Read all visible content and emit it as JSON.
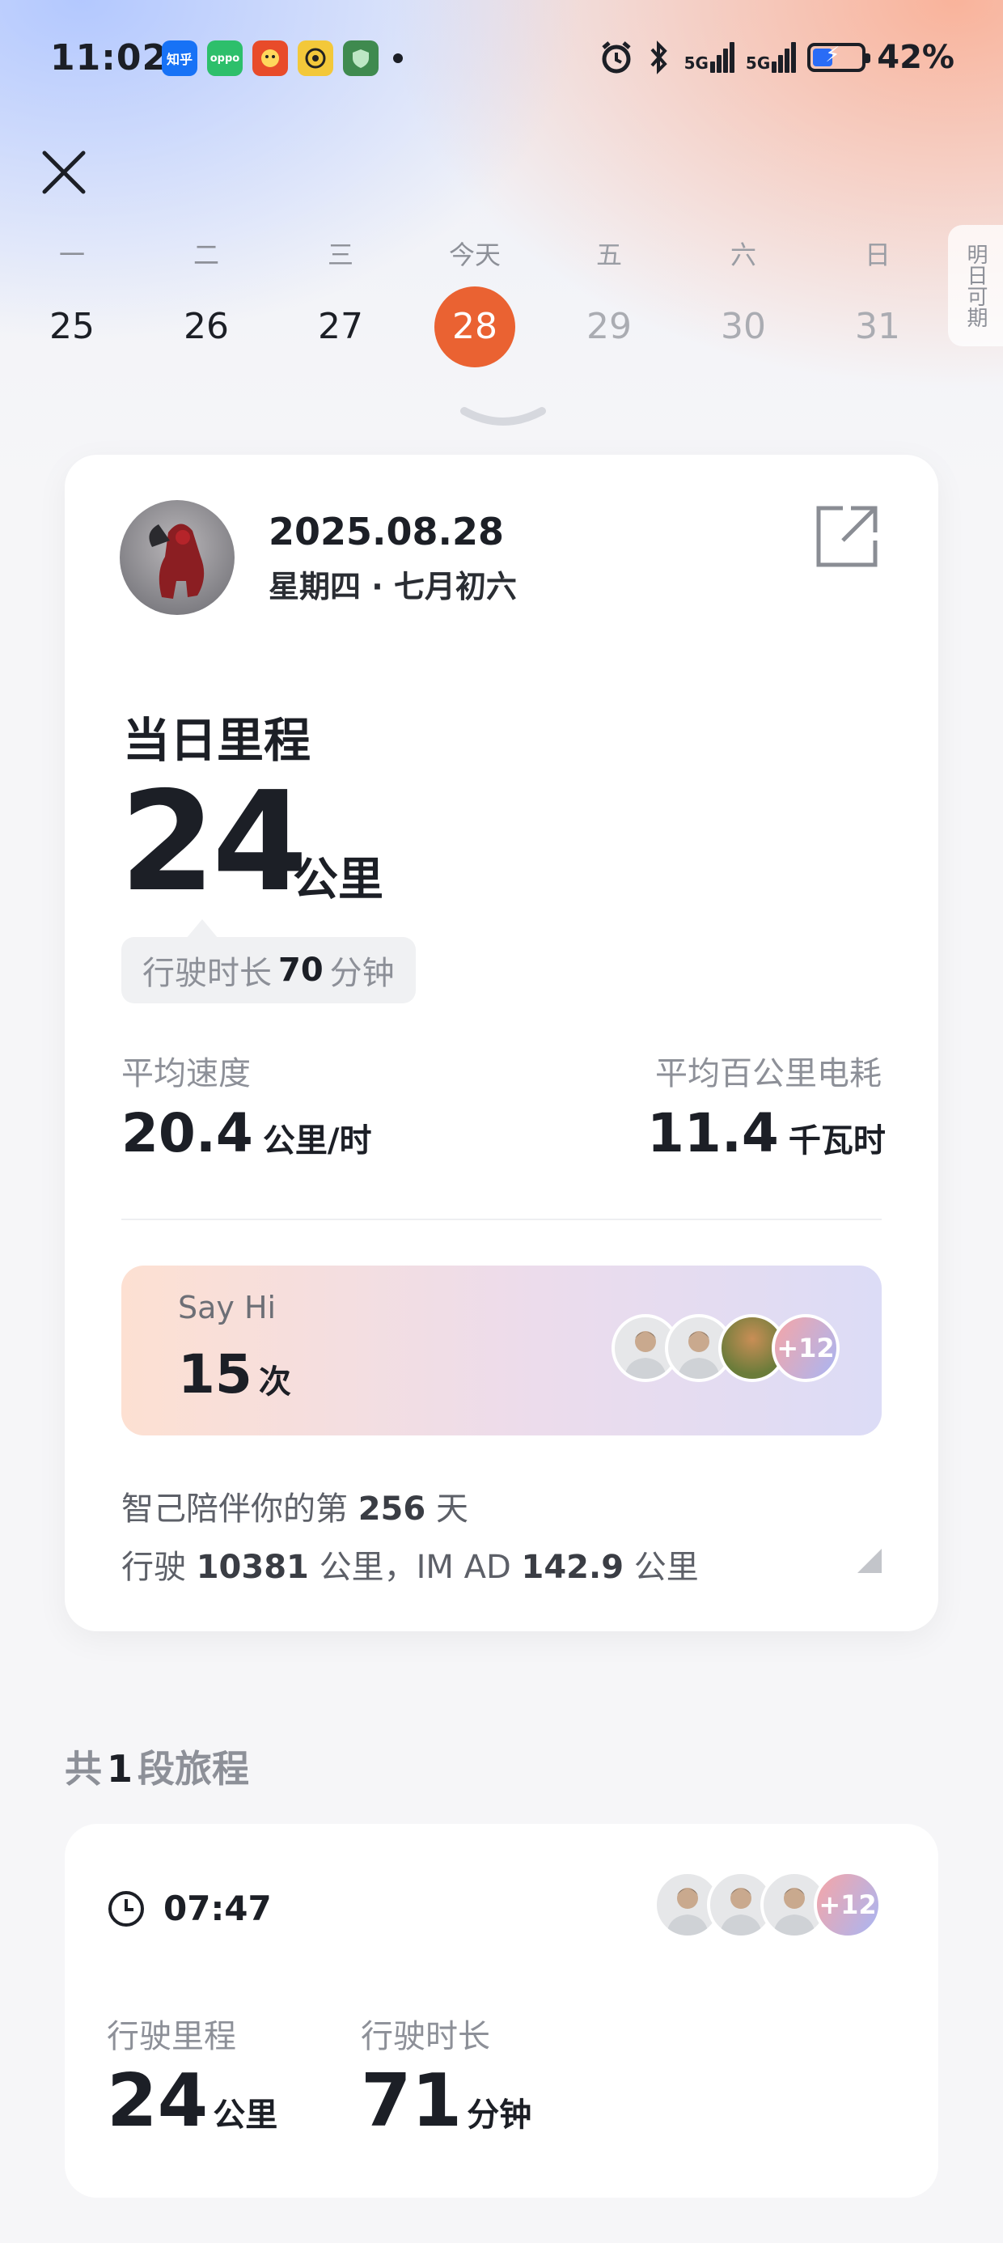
{
  "status_bar": {
    "time": "11:02",
    "apps": [
      {
        "name": "zhihu-app-icon",
        "label": "知乎"
      },
      {
        "name": "oppo-app-icon",
        "label": "oppo"
      },
      {
        "name": "game-app-icon",
        "label": ""
      },
      {
        "name": "music-app-icon",
        "label": ""
      },
      {
        "name": "shield-app-icon",
        "label": ""
      }
    ],
    "network_1": "5G",
    "network_2": "5G",
    "battery_level": 0.42,
    "battery_text": "42%",
    "battery_color": "#2a6cf6"
  },
  "week": {
    "days": [
      {
        "label": "一",
        "num": "25",
        "state": "past"
      },
      {
        "label": "二",
        "num": "26",
        "state": "past"
      },
      {
        "label": "三",
        "num": "27",
        "state": "past"
      },
      {
        "label": "今天",
        "num": "28",
        "state": "today"
      },
      {
        "label": "五",
        "num": "29",
        "state": "future"
      },
      {
        "label": "六",
        "num": "30",
        "state": "future"
      },
      {
        "label": "日",
        "num": "31",
        "state": "future"
      }
    ],
    "next_label": "明日可期",
    "today_color": "#ea6232"
  },
  "summary": {
    "date": "2025.08.28",
    "weekday_lunar": "星期四 · 七月初六",
    "title": "当日里程",
    "distance": "24",
    "distance_unit": "公里",
    "duration_prefix": "行驶时长",
    "duration_value": "70",
    "duration_unit": "分钟",
    "avg_speed_label": "平均速度",
    "avg_speed_value": "20.4",
    "avg_speed_unit": "公里/时",
    "energy_label": "平均百公里电耗",
    "energy_value": "11.4",
    "energy_unit": "千瓦时",
    "sayhi_title": "Say Hi",
    "sayhi_count": "15",
    "sayhi_unit": "次",
    "sayhi_more": "+12",
    "companion_prefix": "智己陪伴你的第",
    "companion_days": "256",
    "companion_suffix": "天",
    "mileage_prefix": "行驶",
    "mileage_total": "10381",
    "mileage_mid": "公里，IM AD",
    "imad_total": "142.9",
    "mileage_suffix": "公里"
  },
  "trips": {
    "heading_prefix": "共",
    "count": "1",
    "heading_suffix": "段旅程",
    "items": [
      {
        "time": "07:47",
        "more": "+12",
        "distance_label": "行驶里程",
        "distance": "24",
        "distance_unit": "公里",
        "duration_label": "行驶时长",
        "duration": "71",
        "duration_unit": "分钟"
      }
    ]
  }
}
